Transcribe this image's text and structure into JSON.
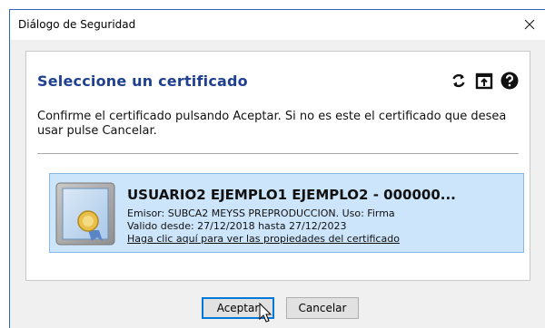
{
  "window": {
    "title": "Diálogo de Seguridad"
  },
  "panel": {
    "heading": "Seleccione un certificado",
    "message": "Confirme el certificado pulsando Aceptar. Si no es este el certificado que desea usar pulse Cancelar.",
    "tools": [
      "refresh-icon",
      "export-icon",
      "help-icon"
    ]
  },
  "certificate": {
    "name": "USUARIO2 EJEMPLO1 EJEMPLO2 - 000000...",
    "issuer_line": "Emisor: SUBCA2 MEYSS PREPRODUCCION. Uso: Firma",
    "validity_line": "Valido desde: 27/12/2018 hasta 27/12/2023",
    "link_text": "Haga clic aquí para ver las propiedades del certificado"
  },
  "buttons": {
    "accept": "Aceptar",
    "cancel": "Cancelar"
  },
  "colors": {
    "heading": "#1f3f8f",
    "cert_bg": "#cde5fb",
    "cert_border": "#86b8e8",
    "window_border": "#2a67b8"
  }
}
